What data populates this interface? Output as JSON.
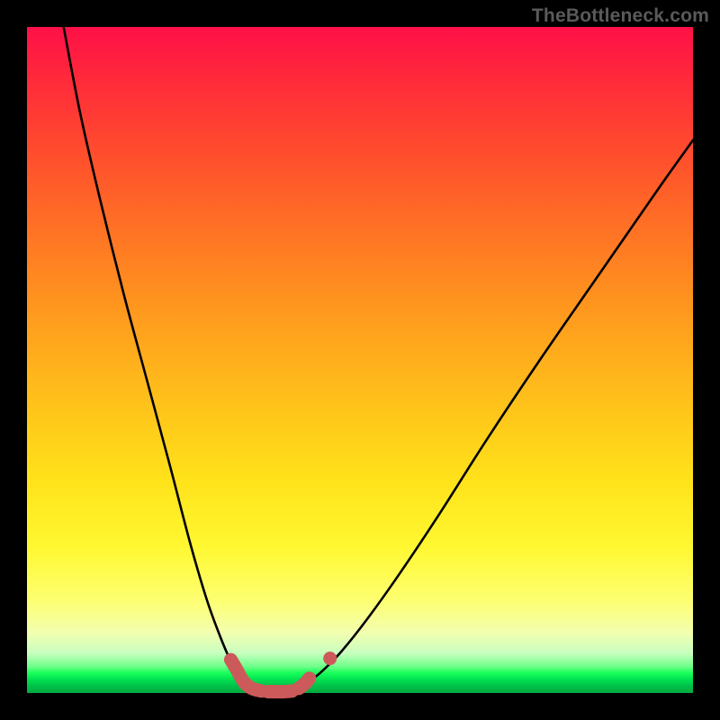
{
  "watermark": "TheBottleneck.com",
  "colors": {
    "frame": "#000000",
    "gradient_top": "#ff1048",
    "gradient_mid": "#ffe21a",
    "gradient_bottom_green": "#00c048",
    "curve_stroke": "#000000",
    "marker_stroke": "#cc5a5a",
    "marker_fill": "#cc5a5a"
  },
  "chart_data": {
    "type": "line",
    "title": "",
    "xlabel": "",
    "ylabel": "",
    "xlim": [
      0,
      1
    ],
    "ylim": [
      0,
      1
    ],
    "series": [
      {
        "name": "left-branch",
        "x": [
          0.055,
          0.08,
          0.11,
          0.145,
          0.18,
          0.215,
          0.245,
          0.27,
          0.29,
          0.305,
          0.318,
          0.33
        ],
        "values": [
          1.0,
          0.87,
          0.74,
          0.6,
          0.47,
          0.34,
          0.225,
          0.14,
          0.085,
          0.05,
          0.028,
          0.015
        ]
      },
      {
        "name": "right-branch",
        "x": [
          0.42,
          0.44,
          0.47,
          0.51,
          0.56,
          0.62,
          0.69,
          0.77,
          0.86,
          0.95,
          1.0
        ],
        "values": [
          0.015,
          0.03,
          0.06,
          0.11,
          0.18,
          0.27,
          0.38,
          0.5,
          0.63,
          0.76,
          0.83
        ]
      },
      {
        "name": "valley-floor",
        "x": [
          0.33,
          0.35,
          0.37,
          0.39,
          0.41,
          0.42
        ],
        "values": [
          0.015,
          0.006,
          0.003,
          0.003,
          0.006,
          0.015
        ]
      }
    ],
    "markers": [
      {
        "name": "left-marker-cluster",
        "points": [
          {
            "x": 0.306,
            "y": 0.05
          },
          {
            "x": 0.315,
            "y": 0.035
          },
          {
            "x": 0.322,
            "y": 0.022
          },
          {
            "x": 0.33,
            "y": 0.012
          },
          {
            "x": 0.34,
            "y": 0.006
          },
          {
            "x": 0.352,
            "y": 0.003
          }
        ]
      },
      {
        "name": "floor-marker-cluster",
        "points": [
          {
            "x": 0.362,
            "y": 0.002
          },
          {
            "x": 0.374,
            "y": 0.002
          },
          {
            "x": 0.386,
            "y": 0.002
          },
          {
            "x": 0.398,
            "y": 0.003
          }
        ]
      },
      {
        "name": "right-marker-cluster",
        "points": [
          {
            "x": 0.408,
            "y": 0.007
          },
          {
            "x": 0.416,
            "y": 0.013
          },
          {
            "x": 0.424,
            "y": 0.022
          }
        ]
      },
      {
        "name": "detached-right-marker",
        "points": [
          {
            "x": 0.455,
            "y": 0.052
          }
        ]
      }
    ]
  }
}
